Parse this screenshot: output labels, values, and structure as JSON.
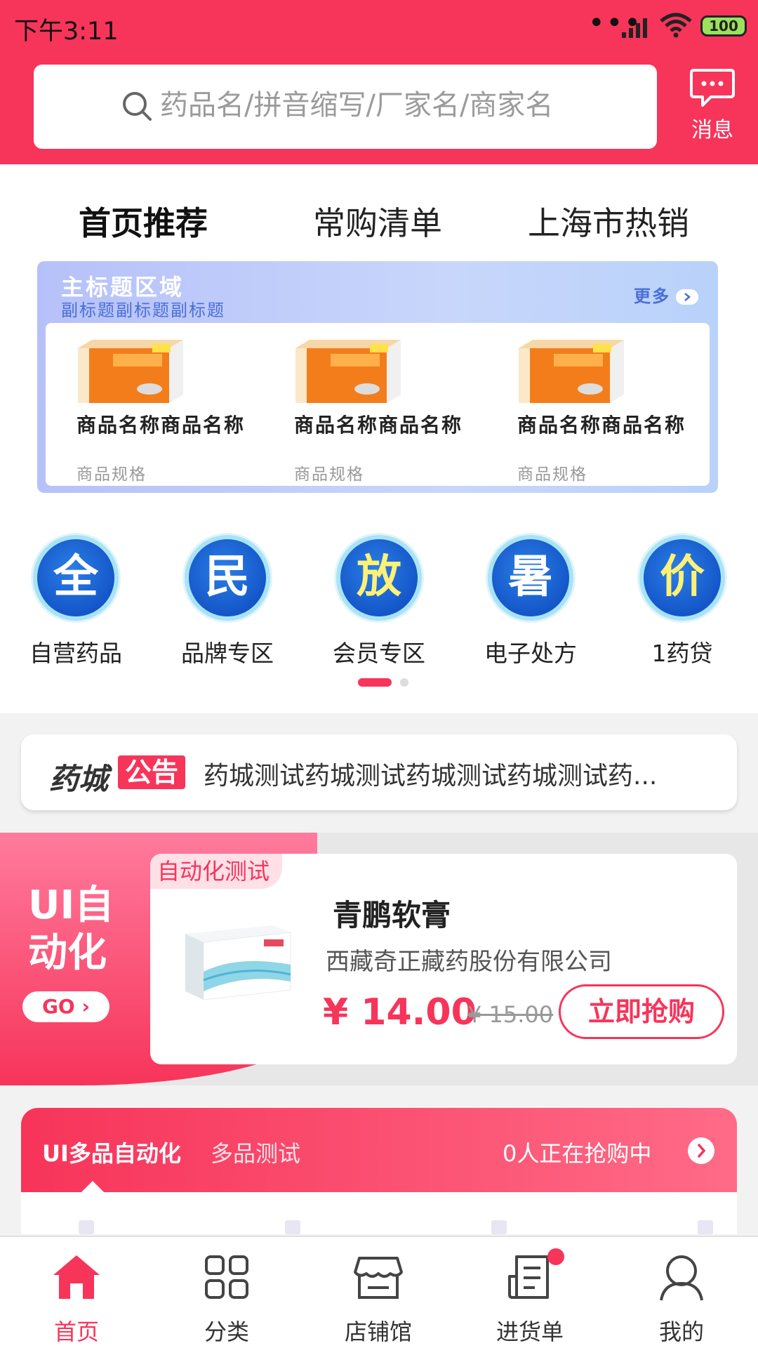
{
  "status_bar": {
    "time": "下午3:11",
    "battery": "100"
  },
  "search": {
    "placeholder": "药品名/拼音缩写/厂家名/商家名"
  },
  "message": {
    "label": "消息"
  },
  "tabs": [
    {
      "label": "首页推荐",
      "active": true
    },
    {
      "label": "常购清单",
      "active": false
    },
    {
      "label": "上海市热销",
      "active": false
    }
  ],
  "banner": {
    "main_title": "主标题区域",
    "sub_title": "副标题副标题副标题",
    "more": "更多",
    "products": [
      {
        "name": "商品名称商品名称",
        "spec": "商品规格"
      },
      {
        "name": "商品名称商品名称",
        "spec": "商品规格"
      },
      {
        "name": "商品名称商品名称",
        "spec": "商品规格"
      }
    ]
  },
  "categories": [
    {
      "glyph": "全",
      "label": "自营药品"
    },
    {
      "glyph": "民",
      "label": "品牌专区"
    },
    {
      "glyph": "放",
      "label": "会员专区"
    },
    {
      "glyph": "暑",
      "label": "电子处方"
    },
    {
      "glyph": "价",
      "label": "1药贷"
    }
  ],
  "notice": {
    "brand": "药城",
    "tag": "公告",
    "text": "药城测试药城测试药城测试药城测试药..."
  },
  "promo": {
    "side_title": "UI自动化",
    "go_label": "GO ›",
    "tag": "自动化测试",
    "product_name": "青鹏软膏",
    "company": "西藏奇正藏药股份有限公司",
    "price": "¥ 14.00",
    "old_price": "¥ 15.00",
    "buy_label": "立即抢购"
  },
  "multi": {
    "title": "UI多品自动化",
    "subtitle": "多品测试",
    "count_text": "0人正在抢购中"
  },
  "nav": [
    {
      "label": "首页",
      "icon": "home-icon",
      "active": true
    },
    {
      "label": "分类",
      "icon": "grid-icon",
      "active": false
    },
    {
      "label": "店铺馆",
      "icon": "store-icon",
      "active": false
    },
    {
      "label": "进货单",
      "icon": "order-list-icon",
      "active": false,
      "badge": true
    },
    {
      "label": "我的",
      "icon": "user-icon",
      "active": false
    }
  ],
  "colors": {
    "brand": "#f7345a",
    "banner_accent": "#4b6fd6"
  }
}
